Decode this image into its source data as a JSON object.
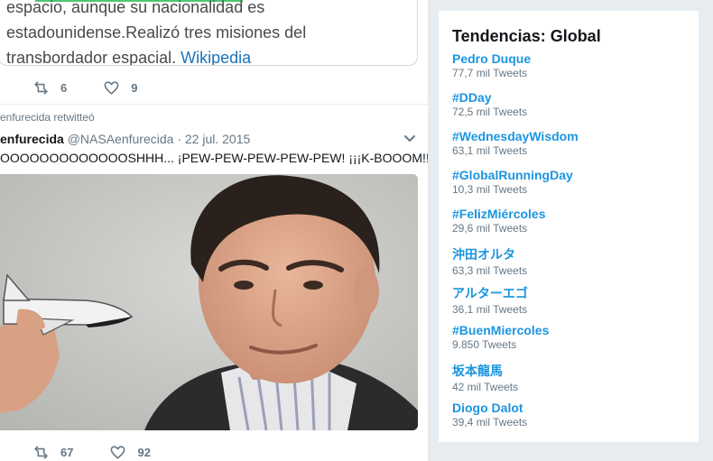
{
  "timeline": {
    "quote": {
      "lines": [
        "espacio, aunque su nacionalidad es",
        "estadounidense.Realizó tres misiones del",
        "transbordador espacial."
      ],
      "link": "Wikipedia"
    },
    "first_actions": {
      "retweets": "6",
      "likes": "9"
    },
    "tweet": {
      "context": "enfurecida retwitteó",
      "author": "enfurecida",
      "handle": "@NASAenfurecida",
      "separator": "·",
      "date": "22 jul. 2015",
      "text": "OOOOOOOOOOOOOSHHH... ¡PEW-PEW-PEW-PEW-PEW! ¡¡¡K-BOOOM!!!",
      "retweets": "67",
      "likes": "92"
    }
  },
  "trends": {
    "title": "Tendencias: Global",
    "items": [
      {
        "name": "Pedro Duque",
        "count": "77,7 mil Tweets"
      },
      {
        "name": "#DDay",
        "count": "72,5 mil Tweets"
      },
      {
        "name": "#WednesdayWisdom",
        "count": "63,1 mil Tweets"
      },
      {
        "name": "#GlobalRunningDay",
        "count": "10,3 mil Tweets"
      },
      {
        "name": "#FelizMiércoles",
        "count": "29,6 mil Tweets"
      },
      {
        "name": "沖田オルタ",
        "count": "63,3 mil Tweets"
      },
      {
        "name": "アルターエゴ",
        "count": "36,1 mil Tweets"
      },
      {
        "name": "#BuenMiercoles",
        "count": "9.850 Tweets"
      },
      {
        "name": "坂本龍馬",
        "count": "42 mil Tweets"
      },
      {
        "name": "Diogo Dalot",
        "count": "39,4 mil Tweets"
      }
    ]
  },
  "colors": {
    "link": "#1b95e0",
    "muted": "#657786",
    "page_bg": "#e6ecf0",
    "highlight": "#4cc76e"
  },
  "icons": {
    "retweet": "retweet-icon",
    "like": "heart-icon",
    "menu": "chevron-down-icon"
  }
}
